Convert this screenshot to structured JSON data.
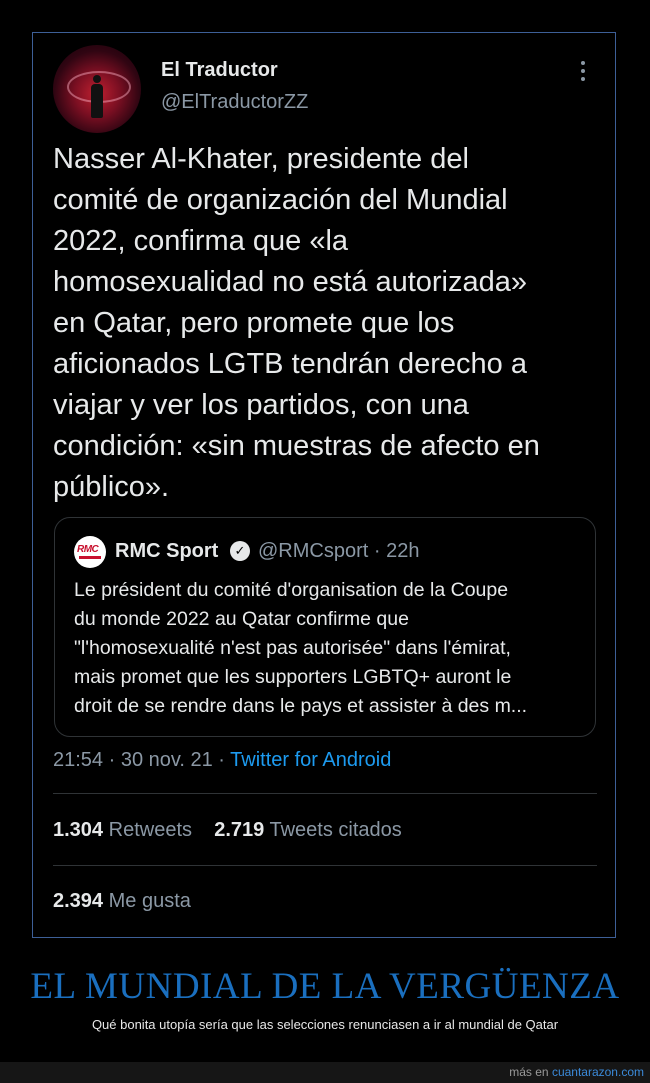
{
  "tweet": {
    "author_name": "El Traductor",
    "author_handle": "@ElTraductorZZ",
    "more_icon": "more-vertical-icon",
    "text": "Nasser Al-Khater, presidente del\ncomité de organización del Mundial\n2022, confirma que «la\nhomosexualidad no está autorizada»\nen Qatar, pero promete que los\naficionados LGTB tendrán derecho a\nviajar y ver los partidos, con una\ncondición: «sin muestras de afecto en\npúblico».",
    "quote": {
      "logo_text": "RMC",
      "name": "RMC Sport",
      "meta": "@RMCsport · 22h",
      "text": "Le président du comité d'organisation de la Coupe\ndu monde 2022 au Qatar confirme que\n\"l'homosexualité n'est pas autorisée\" dans l'émirat,\nmais promet que les supporters LGBTQ+ auront le\ndroit de se rendre dans le pays et assister à des m..."
    },
    "timestamp": "21:54 · 30 nov. 21 · ",
    "source": "Twitter for Android",
    "retweets_count": "1.304",
    "retweets_label": "Retweets",
    "quotes_count": "2.719",
    "quotes_label": "Tweets citados",
    "likes_count": "2.394",
    "likes_label": "Me gusta"
  },
  "post": {
    "title": "EL MUNDIAL DE LA VERGÜENZA",
    "subtitle": "Qué bonita utopía sería que las selecciones renunciasen a ir al mundial de Qatar",
    "footer_prefix": "más en ",
    "footer_link": "cuantarazon.com"
  },
  "colors": {
    "background": "#000000",
    "frame_border": "#3d5f97",
    "link": "#1d9bf0",
    "title": "#1a6fbf"
  }
}
